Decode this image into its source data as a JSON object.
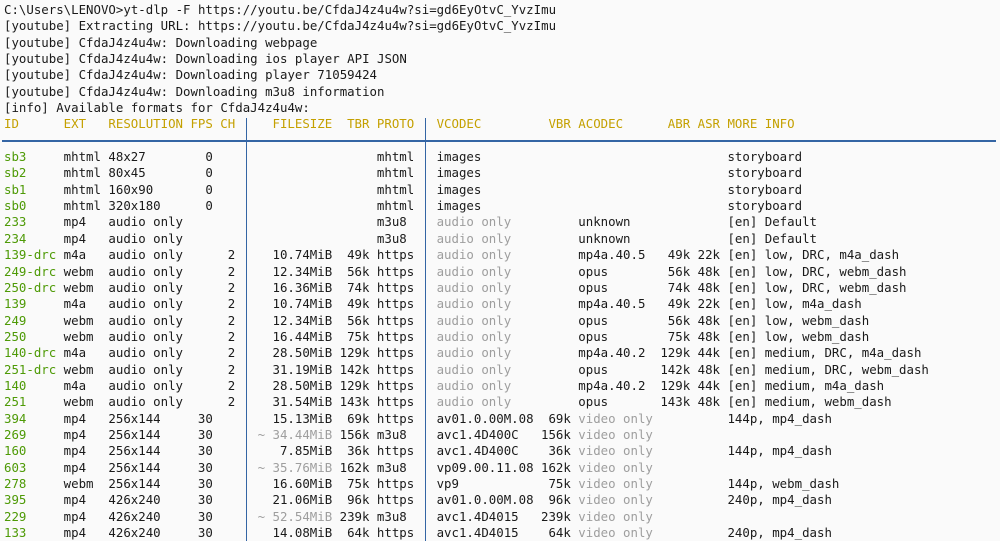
{
  "colors": {
    "background": "#fafafa",
    "text": "#1a1a1a",
    "id_green": "#4e9a06",
    "header_yellow": "#c4a000",
    "delimiter_blue": "#3465a4",
    "muted_gray": "#9e9e9e"
  },
  "preamble": [
    "C:\\Users\\LENOVO>yt-dlp -F https://youtu.be/CfdaJ4z4u4w?si=gd6EyOtvC_YvzImu",
    "[youtube] Extracting URL: https://youtu.be/CfdaJ4z4u4w?si=gd6EyOtvC_YvzImu",
    "[youtube] CfdaJ4z4u4w: Downloading webpage",
    "[youtube] CfdaJ4z4u4w: Downloading ios player API JSON",
    "[youtube] CfdaJ4z4u4w: Downloading player 71059424",
    "[youtube] CfdaJ4z4u4w: Downloading m3u8 information",
    "[info] Available formats for CfdaJ4z4u4w:"
  ],
  "table": {
    "delimiter": "│",
    "headers": {
      "id": "ID",
      "ext": "EXT",
      "res": "RESOLUTION",
      "fps": "FPS",
      "ch": "CH",
      "size": "FILESIZE",
      "tbr": "TBR",
      "proto": "PROTO",
      "vcodec": "VCODEC",
      "vbr": "VBR",
      "acodec": "ACODEC",
      "abr": "ABR",
      "asr": "ASR",
      "more": "MORE INFO"
    },
    "rows": [
      {
        "id": "sb3",
        "ext": "mhtml",
        "res": "48x27",
        "fps": "0",
        "ch": "",
        "size": "",
        "tbr": "",
        "proto": "mhtml",
        "vcodec": "images",
        "vbr": "",
        "acodec": "",
        "abr": "",
        "asr": "",
        "more": "storyboard"
      },
      {
        "id": "sb2",
        "ext": "mhtml",
        "res": "80x45",
        "fps": "0",
        "ch": "",
        "size": "",
        "tbr": "",
        "proto": "mhtml",
        "vcodec": "images",
        "vbr": "",
        "acodec": "",
        "abr": "",
        "asr": "",
        "more": "storyboard"
      },
      {
        "id": "sb1",
        "ext": "mhtml",
        "res": "160x90",
        "fps": "0",
        "ch": "",
        "size": "",
        "tbr": "",
        "proto": "mhtml",
        "vcodec": "images",
        "vbr": "",
        "acodec": "",
        "abr": "",
        "asr": "",
        "more": "storyboard"
      },
      {
        "id": "sb0",
        "ext": "mhtml",
        "res": "320x180",
        "fps": "0",
        "ch": "",
        "size": "",
        "tbr": "",
        "proto": "mhtml",
        "vcodec": "images",
        "vbr": "",
        "acodec": "",
        "abr": "",
        "asr": "",
        "more": "storyboard"
      },
      {
        "id": "233",
        "ext": "mp4",
        "res": "audio only",
        "fps": "",
        "ch": "",
        "size": "",
        "tbr": "",
        "proto": "m3u8",
        "vcodec": "audio only",
        "vbr": "",
        "acodec": "unknown",
        "abr": "",
        "asr": "",
        "more": "[en] Default"
      },
      {
        "id": "234",
        "ext": "mp4",
        "res": "audio only",
        "fps": "",
        "ch": "",
        "size": "",
        "tbr": "",
        "proto": "m3u8",
        "vcodec": "audio only",
        "vbr": "",
        "acodec": "unknown",
        "abr": "",
        "asr": "",
        "more": "[en] Default"
      },
      {
        "id": "139-drc",
        "ext": "m4a",
        "res": "audio only",
        "fps": "",
        "ch": "2",
        "size": "10.74MiB",
        "tbr": "49k",
        "proto": "https",
        "vcodec": "audio only",
        "vbr": "",
        "acodec": "mp4a.40.5",
        "abr": "49k",
        "asr": "22k",
        "more": "[en] low, DRC, m4a_dash"
      },
      {
        "id": "249-drc",
        "ext": "webm",
        "res": "audio only",
        "fps": "",
        "ch": "2",
        "size": "12.34MiB",
        "tbr": "56k",
        "proto": "https",
        "vcodec": "audio only",
        "vbr": "",
        "acodec": "opus",
        "abr": "56k",
        "asr": "48k",
        "more": "[en] low, DRC, webm_dash"
      },
      {
        "id": "250-drc",
        "ext": "webm",
        "res": "audio only",
        "fps": "",
        "ch": "2",
        "size": "16.36MiB",
        "tbr": "74k",
        "proto": "https",
        "vcodec": "audio only",
        "vbr": "",
        "acodec": "opus",
        "abr": "74k",
        "asr": "48k",
        "more": "[en] low, DRC, webm_dash"
      },
      {
        "id": "139",
        "ext": "m4a",
        "res": "audio only",
        "fps": "",
        "ch": "2",
        "size": "10.74MiB",
        "tbr": "49k",
        "proto": "https",
        "vcodec": "audio only",
        "vbr": "",
        "acodec": "mp4a.40.5",
        "abr": "49k",
        "asr": "22k",
        "more": "[en] low, m4a_dash"
      },
      {
        "id": "249",
        "ext": "webm",
        "res": "audio only",
        "fps": "",
        "ch": "2",
        "size": "12.34MiB",
        "tbr": "56k",
        "proto": "https",
        "vcodec": "audio only",
        "vbr": "",
        "acodec": "opus",
        "abr": "56k",
        "asr": "48k",
        "more": "[en] low, webm_dash"
      },
      {
        "id": "250",
        "ext": "webm",
        "res": "audio only",
        "fps": "",
        "ch": "2",
        "size": "16.44MiB",
        "tbr": "75k",
        "proto": "https",
        "vcodec": "audio only",
        "vbr": "",
        "acodec": "opus",
        "abr": "75k",
        "asr": "48k",
        "more": "[en] low, webm_dash"
      },
      {
        "id": "140-drc",
        "ext": "m4a",
        "res": "audio only",
        "fps": "",
        "ch": "2",
        "size": "28.50MiB",
        "tbr": "129k",
        "proto": "https",
        "vcodec": "audio only",
        "vbr": "",
        "acodec": "mp4a.40.2",
        "abr": "129k",
        "asr": "44k",
        "more": "[en] medium, DRC, m4a_dash"
      },
      {
        "id": "251-drc",
        "ext": "webm",
        "res": "audio only",
        "fps": "",
        "ch": "2",
        "size": "31.19MiB",
        "tbr": "142k",
        "proto": "https",
        "vcodec": "audio only",
        "vbr": "",
        "acodec": "opus",
        "abr": "142k",
        "asr": "48k",
        "more": "[en] medium, DRC, webm_dash"
      },
      {
        "id": "140",
        "ext": "m4a",
        "res": "audio only",
        "fps": "",
        "ch": "2",
        "size": "28.50MiB",
        "tbr": "129k",
        "proto": "https",
        "vcodec": "audio only",
        "vbr": "",
        "acodec": "mp4a.40.2",
        "abr": "129k",
        "asr": "44k",
        "more": "[en] medium, m4a_dash"
      },
      {
        "id": "251",
        "ext": "webm",
        "res": "audio only",
        "fps": "",
        "ch": "2",
        "size": "31.54MiB",
        "tbr": "143k",
        "proto": "https",
        "vcodec": "audio only",
        "vbr": "",
        "acodec": "opus",
        "abr": "143k",
        "asr": "48k",
        "more": "[en] medium, webm_dash"
      },
      {
        "id": "394",
        "ext": "mp4",
        "res": "256x144",
        "fps": "30",
        "ch": "",
        "size": "15.13MiB",
        "tbr": "69k",
        "proto": "https",
        "vcodec": "av01.0.00M.08",
        "vbr": "69k",
        "acodec": "video only",
        "abr": "",
        "asr": "",
        "more": "144p, mp4_dash"
      },
      {
        "id": "269",
        "ext": "mp4",
        "res": "256x144",
        "fps": "30",
        "ch": "",
        "size": "~ 34.44MiB",
        "tbr": "156k",
        "proto": "m3u8",
        "vcodec": "avc1.4D400C",
        "vbr": "156k",
        "acodec": "video only",
        "abr": "",
        "asr": "",
        "more": ""
      },
      {
        "id": "160",
        "ext": "mp4",
        "res": "256x144",
        "fps": "30",
        "ch": "",
        "size": "7.85MiB",
        "tbr": "36k",
        "proto": "https",
        "vcodec": "avc1.4D400C",
        "vbr": "36k",
        "acodec": "video only",
        "abr": "",
        "asr": "",
        "more": "144p, mp4_dash"
      },
      {
        "id": "603",
        "ext": "mp4",
        "res": "256x144",
        "fps": "30",
        "ch": "",
        "size": "~ 35.76MiB",
        "tbr": "162k",
        "proto": "m3u8",
        "vcodec": "vp09.00.11.08",
        "vbr": "162k",
        "acodec": "video only",
        "abr": "",
        "asr": "",
        "more": ""
      },
      {
        "id": "278",
        "ext": "webm",
        "res": "256x144",
        "fps": "30",
        "ch": "",
        "size": "16.60MiB",
        "tbr": "75k",
        "proto": "https",
        "vcodec": "vp9",
        "vbr": "75k",
        "acodec": "video only",
        "abr": "",
        "asr": "",
        "more": "144p, webm_dash"
      },
      {
        "id": "395",
        "ext": "mp4",
        "res": "426x240",
        "fps": "30",
        "ch": "",
        "size": "21.06MiB",
        "tbr": "96k",
        "proto": "https",
        "vcodec": "av01.0.00M.08",
        "vbr": "96k",
        "acodec": "video only",
        "abr": "",
        "asr": "",
        "more": "240p, mp4_dash"
      },
      {
        "id": "229",
        "ext": "mp4",
        "res": "426x240",
        "fps": "30",
        "ch": "",
        "size": "~ 52.54MiB",
        "tbr": "239k",
        "proto": "m3u8",
        "vcodec": "avc1.4D4015",
        "vbr": "239k",
        "acodec": "video only",
        "abr": "",
        "asr": "",
        "more": ""
      },
      {
        "id": "133",
        "ext": "mp4",
        "res": "426x240",
        "fps": "30",
        "ch": "",
        "size": "14.08MiB",
        "tbr": "64k",
        "proto": "https",
        "vcodec": "avc1.4D4015",
        "vbr": "64k",
        "acodec": "video only",
        "abr": "",
        "asr": "",
        "more": "240p, mp4_dash"
      }
    ]
  }
}
